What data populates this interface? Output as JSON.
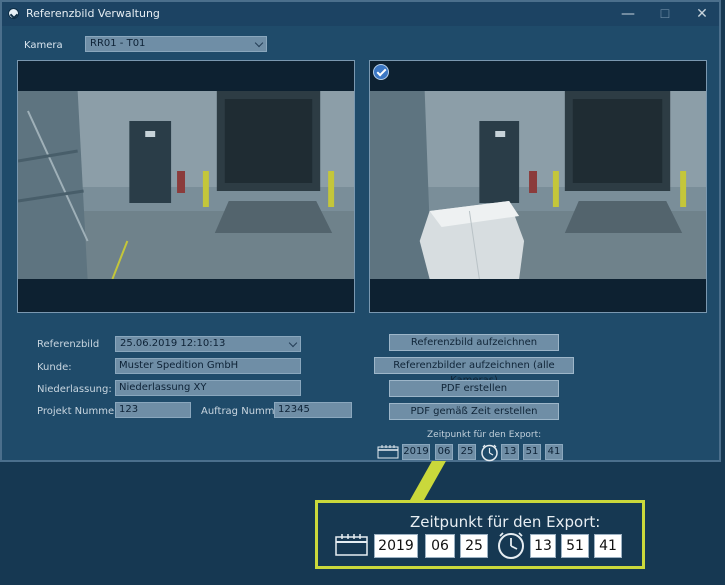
{
  "window": {
    "title": "Referenzbild Verwaltung",
    "controls": {
      "minimize": "—",
      "maximize": "☐",
      "close": "✕"
    }
  },
  "camera": {
    "label": "Kamera",
    "selected": "RR01 - T01"
  },
  "views": {
    "left": {
      "scene": "warehouse loading dock, empty floor"
    },
    "right": {
      "scene": "warehouse loading dock with wrapped pallets",
      "badge_icon": "check-icon"
    }
  },
  "form": {
    "referenzbild": {
      "label": "Referenzbild",
      "value": "25.06.2019 12:10:13"
    },
    "kunde": {
      "label": "Kunde:",
      "value": "Muster Spedition GmbH"
    },
    "niederlassung": {
      "label": "Niederlassung:",
      "value": "Niederlassung XY"
    },
    "projekt": {
      "label": "Projekt Nummer:",
      "value": "123"
    },
    "auftrag": {
      "label": "Auftrag Nummer:",
      "value": "12345"
    }
  },
  "buttons": {
    "record": "Referenzbild aufzeichnen",
    "record_all": "Referenzbilder aufzeichnen (alle Kameras)",
    "pdf": "PDF erstellen",
    "pdf_time": "PDF gemäß Zeit erstellen"
  },
  "export": {
    "label": "Zeitpunkt für den Export:",
    "year": "2019",
    "month": "06",
    "day": "25",
    "hour": "13",
    "minute": "51",
    "second": "41",
    "calendar_icon": "calendar-icon",
    "clock_icon": "clock-icon"
  },
  "colors": {
    "window_bg": "#1f4b6a",
    "desktop_bg": "#163852",
    "field_bg": "#6f8ea6",
    "callout_border": "#cad83b"
  }
}
